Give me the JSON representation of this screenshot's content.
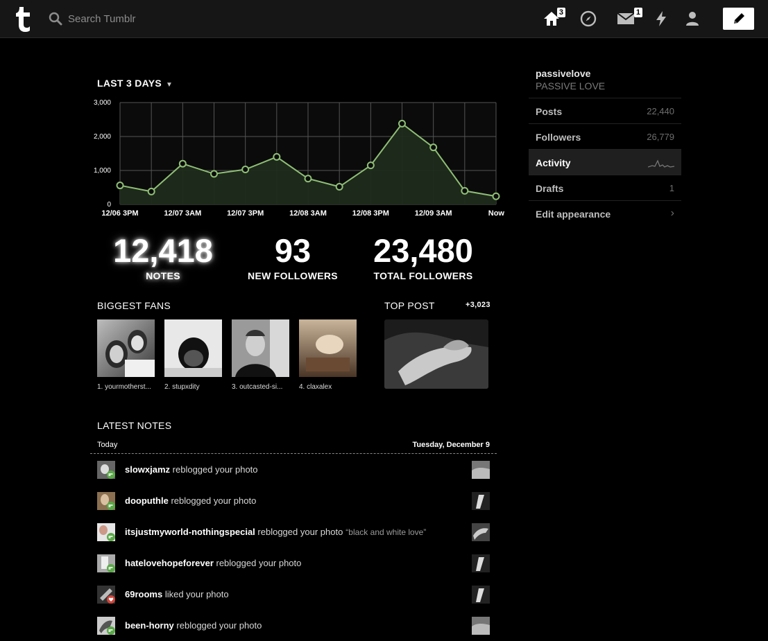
{
  "search": {
    "placeholder": "Search Tumblr"
  },
  "nav": {
    "home_badge": "3",
    "inbox_badge": "1"
  },
  "activity": {
    "range_label": "LAST 3 DAYS",
    "stats": [
      {
        "value": "12,418",
        "label": "NOTES"
      },
      {
        "value": "93",
        "label": "NEW FOLLOWERS"
      },
      {
        "value": "23,480",
        "label": "TOTAL FOLLOWERS"
      }
    ],
    "biggest_fans_title": "BIGGEST FANS",
    "fans": [
      "1. yourmotherst...",
      "2. stupxdity",
      "3. outcasted-si...",
      "4. claxalex"
    ],
    "top_post_title": "TOP POST",
    "top_post_count": "+3,023",
    "latest_notes_title": "LATEST NOTES",
    "notes_today": "Today",
    "notes_date": "Tuesday, December 9",
    "notes": [
      {
        "user": "slowxjamz",
        "action": "reblogged your photo",
        "quote": "",
        "type": "reblog"
      },
      {
        "user": "dooputhle",
        "action": "reblogged your photo",
        "quote": "",
        "type": "reblog"
      },
      {
        "user": "itsjustmyworld-nothingspecial",
        "action": "reblogged your photo",
        "quote": "“black and white love”",
        "type": "reblog"
      },
      {
        "user": "hatelovehopeforever",
        "action": "reblogged your photo",
        "quote": "",
        "type": "reblog"
      },
      {
        "user": "69rooms",
        "action": "liked your photo",
        "quote": "",
        "type": "like"
      },
      {
        "user": "been-horny",
        "action": "reblogged your photo",
        "quote": "",
        "type": "reblog"
      }
    ]
  },
  "chart_data": {
    "type": "area",
    "x": [
      "12/06 3PM",
      "",
      "12/07 3AM",
      "",
      "12/07 3PM",
      "",
      "12/08 3AM",
      "",
      "12/08 3PM",
      "",
      "12/09 3AM",
      "",
      "Now"
    ],
    "tick_labels": [
      "12/06 3PM",
      "12/07 3AM",
      "12/07 3PM",
      "12/08 3AM",
      "12/08 3PM",
      "12/09 3AM",
      "Now"
    ],
    "values": [
      560,
      380,
      1200,
      900,
      1030,
      1400,
      760,
      520,
      1150,
      2380,
      1680,
      400,
      240
    ],
    "ylim": [
      0,
      3000
    ],
    "yticks": [
      0,
      1000,
      2000,
      3000
    ],
    "ytick_labels": [
      "0",
      "1,000",
      "2,000",
      "3,000"
    ],
    "grid": true,
    "colors": {
      "line": "#8fbf76",
      "fill": "#1f2b1b"
    }
  },
  "sidebar": {
    "blog_name": "passivelove",
    "blog_title": "PASSIVE LOVE",
    "items": [
      {
        "label": "Posts",
        "value": "22,440"
      },
      {
        "label": "Followers",
        "value": "26,779"
      },
      {
        "label": "Activity",
        "value": ""
      },
      {
        "label": "Drafts",
        "value": "1"
      },
      {
        "label": "Edit appearance",
        "value": ""
      }
    ]
  }
}
